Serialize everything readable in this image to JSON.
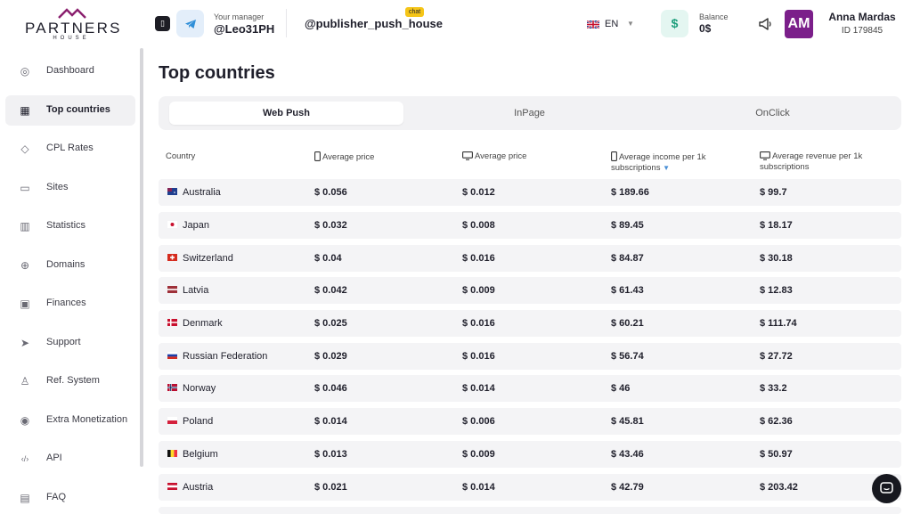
{
  "brand": {
    "name": "PARTNERS",
    "sub": "HOUSE"
  },
  "header": {
    "manager_label": "Your manager",
    "manager_name": "@Leo31PH",
    "publisher": "@publisher_push_house",
    "chat_badge": "chat",
    "language": "EN",
    "balance_label": "Balance",
    "balance_value": "0$",
    "balance_icon": "$",
    "user_initials": "AM",
    "user_name": "Anna Mardas",
    "user_id": "ID 179845"
  },
  "sidebar": {
    "items": [
      {
        "label": "Dashboard",
        "icon": "location-pin-icon",
        "glyph": "◎",
        "active": false
      },
      {
        "label": "Top countries",
        "icon": "grid-icon",
        "glyph": "▦",
        "active": true
      },
      {
        "label": "CPL Rates",
        "icon": "tag-icon",
        "glyph": "◇",
        "active": false
      },
      {
        "label": "Sites",
        "icon": "monitor-icon",
        "glyph": "▭",
        "active": false
      },
      {
        "label": "Statistics",
        "icon": "bar-chart-icon",
        "glyph": "▥",
        "active": false
      },
      {
        "label": "Domains",
        "icon": "globe-icon",
        "glyph": "⊕",
        "active": false
      },
      {
        "label": "Finances",
        "icon": "wallet-icon",
        "glyph": "▣",
        "active": false
      },
      {
        "label": "Support",
        "icon": "send-icon",
        "glyph": "➤",
        "active": false
      },
      {
        "label": "Ref. System",
        "icon": "user-icon",
        "glyph": "♙",
        "active": false
      },
      {
        "label": "Extra Monetization",
        "icon": "coin-icon",
        "glyph": "◉",
        "active": false
      },
      {
        "label": "API",
        "icon": "code-icon",
        "glyph": "‹/›",
        "active": false
      },
      {
        "label": "FAQ",
        "icon": "chat-icon",
        "glyph": "▤",
        "active": false
      }
    ]
  },
  "main": {
    "title": "Top countries",
    "tabs": [
      {
        "label": "Web Push",
        "active": true
      },
      {
        "label": "InPage",
        "active": false
      },
      {
        "label": "OnClick",
        "active": false
      }
    ],
    "columns": [
      {
        "label": "Country",
        "device": ""
      },
      {
        "label": "Average price",
        "device": "mobile"
      },
      {
        "label": "Average price",
        "device": "desktop"
      },
      {
        "label": "Average income per 1k subscriptions",
        "device": "mobile",
        "sorted": true
      },
      {
        "label": "Average revenue per 1k subscriptions",
        "device": "desktop"
      }
    ],
    "rows": [
      {
        "country": "Australia",
        "flag": "au",
        "mobile_price": "$ 0.056",
        "desktop_price": "$ 0.012",
        "mobile_income": "$ 189.66",
        "desktop_revenue": "$ 99.7"
      },
      {
        "country": "Japan",
        "flag": "jp",
        "mobile_price": "$ 0.032",
        "desktop_price": "$ 0.008",
        "mobile_income": "$ 89.45",
        "desktop_revenue": "$ 18.17"
      },
      {
        "country": "Switzerland",
        "flag": "ch",
        "mobile_price": "$ 0.04",
        "desktop_price": "$ 0.016",
        "mobile_income": "$ 84.87",
        "desktop_revenue": "$ 30.18"
      },
      {
        "country": "Latvia",
        "flag": "lv",
        "mobile_price": "$ 0.042",
        "desktop_price": "$ 0.009",
        "mobile_income": "$ 61.43",
        "desktop_revenue": "$ 12.83"
      },
      {
        "country": "Denmark",
        "flag": "dk",
        "mobile_price": "$ 0.025",
        "desktop_price": "$ 0.016",
        "mobile_income": "$ 60.21",
        "desktop_revenue": "$ 111.74"
      },
      {
        "country": "Russian Federation",
        "flag": "ru",
        "mobile_price": "$ 0.029",
        "desktop_price": "$ 0.016",
        "mobile_income": "$ 56.74",
        "desktop_revenue": "$ 27.72"
      },
      {
        "country": "Norway",
        "flag": "no",
        "mobile_price": "$ 0.046",
        "desktop_price": "$ 0.014",
        "mobile_income": "$ 46",
        "desktop_revenue": "$ 33.2"
      },
      {
        "country": "Poland",
        "flag": "pl",
        "mobile_price": "$ 0.014",
        "desktop_price": "$ 0.006",
        "mobile_income": "$ 45.81",
        "desktop_revenue": "$ 62.36"
      },
      {
        "country": "Belgium",
        "flag": "be",
        "mobile_price": "$ 0.013",
        "desktop_price": "$ 0.009",
        "mobile_income": "$ 43.46",
        "desktop_revenue": "$ 50.97"
      },
      {
        "country": "Austria",
        "flag": "at",
        "mobile_price": "$ 0.021",
        "desktop_price": "$ 0.014",
        "mobile_income": "$ 42.79",
        "desktop_revenue": "$ 203.42"
      }
    ]
  },
  "colors": {
    "accent": "#7b1f8a",
    "active_bg": "#f1f1f3",
    "row_bg": "#f4f4f6",
    "balance_green": "#1b9e7b",
    "telegram_blue": "#2f8fd8"
  }
}
